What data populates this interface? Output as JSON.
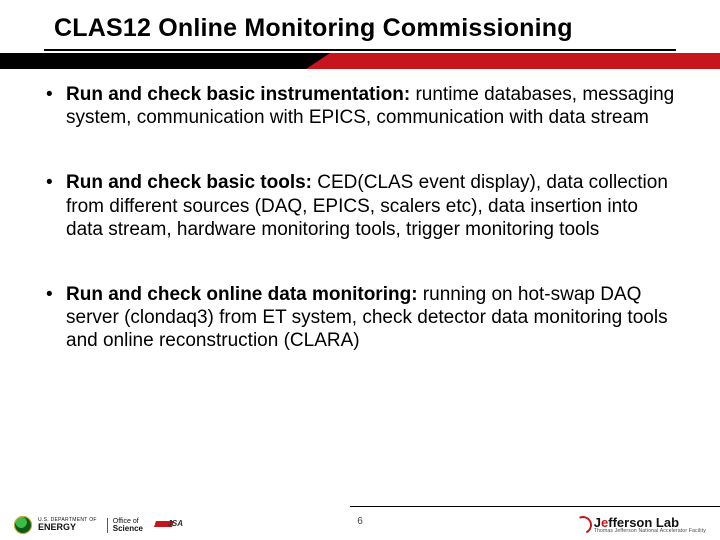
{
  "title": "CLAS12 Online Monitoring Commissioning",
  "bullets": [
    {
      "lead": "Run and check basic instrumentation:",
      "rest": " runtime databases, messaging system, communication with EPICS, communication with data stream"
    },
    {
      "lead": "Run and check basic tools:",
      "rest": " CED(CLAS event display), data collection from different sources (DAQ, EPICS, scalers etc), data insertion into data stream, hardware monitoring tools, trigger monitoring tools"
    },
    {
      "lead": "Run and check online data monitoring:",
      "rest": " running on hot-swap DAQ server (clondaq3) from ET system, check detector data monitoring tools and online reconstruction (CLARA)"
    }
  ],
  "page_number": "6",
  "logos": {
    "doe_top": "U.S. DEPARTMENT OF",
    "doe_bot": "ENERGY",
    "office_top": "Office of",
    "office_bot": "Science",
    "jsa": "JSA",
    "jlab_main_pre": "J",
    "jlab_main_e": "e",
    "jlab_main_post": "fferson Lab",
    "jlab_sub": "Thomas Jefferson National Accelerator Facility"
  }
}
